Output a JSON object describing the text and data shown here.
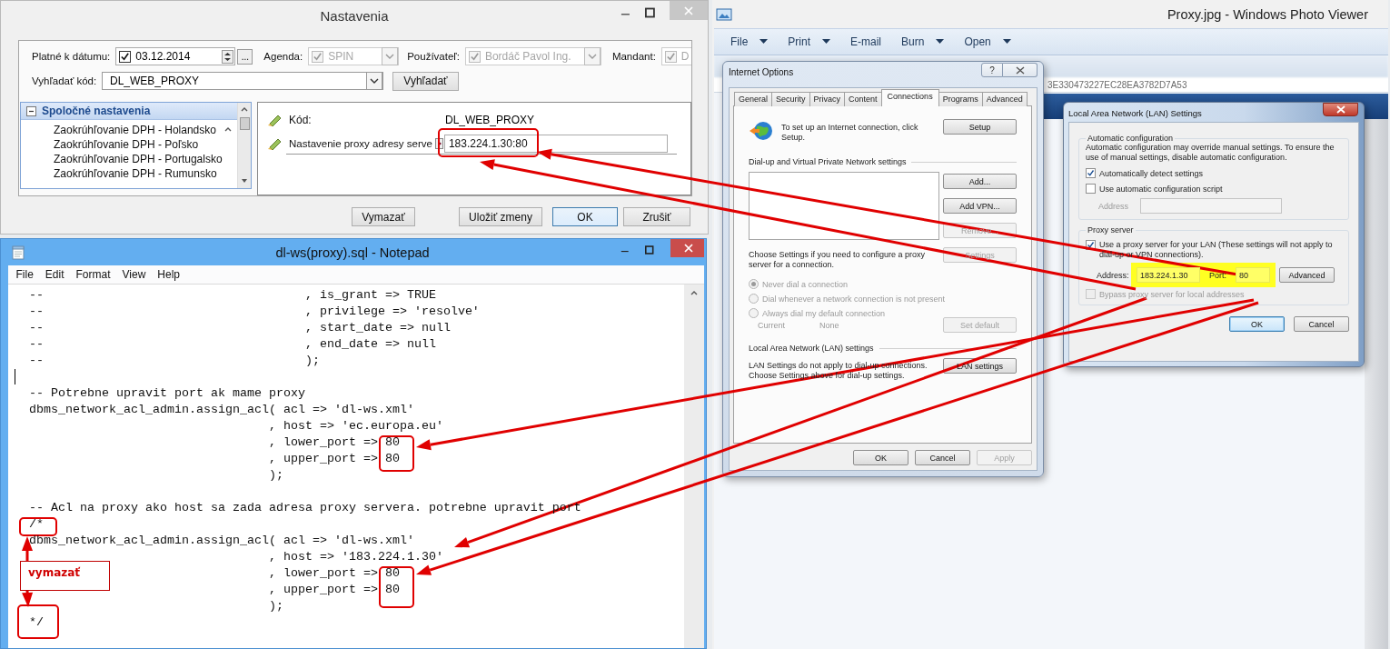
{
  "settings_window": {
    "title": "Nastavenia",
    "filters": [
      {
        "kind": "date",
        "label": "Platné k dátumu:",
        "checked": true,
        "disabled": false,
        "value": "03.12.2014",
        "browse": "..."
      },
      {
        "kind": "combo",
        "label": "Agenda:",
        "checked": true,
        "disabled": true,
        "value": "SPIN"
      },
      {
        "kind": "combo",
        "label": "Používateľ:",
        "checked": true,
        "disabled": true,
        "value": "Bordáč Pavol Ing."
      },
      {
        "kind": "combo",
        "label": "Mandant:",
        "checked": true,
        "disabled": true,
        "value": "D"
      }
    ],
    "search": {
      "label": "Vyhľadať kód:",
      "value": "DL_WEB_PROXY",
      "button": "Vyhľadať"
    },
    "tree": {
      "header": "Spoločné nastavenia",
      "expanded": true,
      "items": [
        "Zaokrúhľovanie DPH - Holandsko",
        "Zaokrúhľovanie DPH - Poľsko",
        "Zaokrúhľovanie DPH - Portugalsko",
        "Zaokrúhľovanie DPH - Rumunsko"
      ]
    },
    "details": [
      {
        "kind": "text",
        "label": "Kód:",
        "value": "DL_WEB_PROXY"
      },
      {
        "kind": "field",
        "label": "Nastavenie proxy adresy serve",
        "value": "183.224.1.30:80"
      }
    ],
    "buttons": [
      {
        "label": "Vymazať",
        "default": false
      },
      {
        "label": "Uložiť zmeny",
        "default": false
      },
      {
        "label": "OK",
        "default": true
      },
      {
        "label": "Zrušiť",
        "default": false
      }
    ]
  },
  "notepad": {
    "title": "dl-ws(proxy).sql - Notepad",
    "menu": [
      "File",
      "Edit",
      "Format",
      "View",
      "Help"
    ],
    "blocks": [
      {
        "caret_after": true,
        "lines": [
          "--                                    , is_grant => TRUE",
          "--                                    , privilege => 'resolve'",
          "--                                    , start_date => null",
          "--                                    , end_date => null",
          "--                                    );"
        ]
      },
      {
        "caret_after": false,
        "lines": [
          "-- Potrebne upravit port ak mame proxy",
          "dbms_network_acl_admin.assign_acl( acl => 'dl-ws.xml'",
          "                                 , host => 'ec.europa.eu'",
          "                                 , lower_port => 80",
          "                                 , upper_port => 80",
          "                                 );"
        ]
      },
      {
        "caret_after": false,
        "lines": [
          "-- Acl na proxy ako host sa zada adresa proxy servera. potrebne upravit port",
          "/*",
          "dbms_network_acl_admin.assign_acl( acl => 'dl-ws.xml'",
          "                                 , host => '183.224.1.30'",
          "                                 , lower_port => 80",
          "                                 , upper_port => 80",
          "                                 );",
          "*/"
        ]
      }
    ]
  },
  "photo_viewer": {
    "title": "Proxy.jpg - Windows Photo Viewer",
    "toolbar": [
      {
        "label": "File",
        "dropdown": true
      },
      {
        "label": "Print",
        "dropdown": true
      },
      {
        "label": "E-mail",
        "dropdown": false
      },
      {
        "label": "Burn",
        "dropdown": true
      },
      {
        "label": "Open",
        "dropdown": true
      }
    ],
    "image": {
      "address": "3E330473227EC28EA3782D7A53",
      "internet_options": {
        "title": "Internet Options",
        "help": "?",
        "tabs": [
          {
            "label": "General",
            "selected": false
          },
          {
            "label": "Security",
            "selected": false
          },
          {
            "label": "Privacy",
            "selected": false
          },
          {
            "label": "Content",
            "selected": false
          },
          {
            "label": "Connections",
            "selected": true
          },
          {
            "label": "Programs",
            "selected": false
          },
          {
            "label": "Advanced",
            "selected": false
          }
        ],
        "setup_text": "To set up an Internet connection, click Setup.",
        "setup_button": "Setup",
        "dialup_group": "Dial-up and Virtual Private Network settings",
        "dialup_buttons": [
          {
            "label": "Add...",
            "disabled": false
          },
          {
            "label": "Add VPN...",
            "disabled": false
          },
          {
            "label": "Remove...",
            "disabled": true
          },
          {
            "label": "Settings",
            "disabled": true
          }
        ],
        "proxy_text": "Choose Settings if you need to configure a proxy server for a connection.",
        "dial_options": [
          {
            "label": "Never dial a connection",
            "selected": true,
            "disabled": true
          },
          {
            "label": "Dial whenever a network connection is not present",
            "selected": false,
            "disabled": true
          },
          {
            "label": "Always dial my default connection",
            "selected": false,
            "disabled": true
          }
        ],
        "current_label": "Current",
        "current_value": "None",
        "set_default": {
          "label": "Set default",
          "disabled": true
        },
        "lan_group": "Local Area Network (LAN) settings",
        "lan_text": "LAN Settings do not apply to dial-up connections. Choose Settings above for dial-up settings.",
        "lan_button": "LAN settings",
        "footer": [
          {
            "label": "OK",
            "disabled": false
          },
          {
            "label": "Cancel",
            "disabled": false
          },
          {
            "label": "Apply",
            "disabled": true
          }
        ]
      },
      "lan_settings": {
        "title": "Local Area Network (LAN) Settings",
        "auto_group": "Automatic configuration",
        "auto_text": "Automatic configuration may override manual settings. To ensure the use of manual settings, disable automatic configuration.",
        "options": [
          {
            "label": "Automatically detect settings",
            "checked": true
          },
          {
            "label": "Use automatic configuration script",
            "checked": false
          }
        ],
        "script_address": {
          "label": "Address",
          "disabled": true
        },
        "proxy_group": "Proxy server",
        "proxy_option": {
          "label": "Use a proxy server for your LAN (These settings will not apply to dial-up or VPN connections).",
          "checked": true
        },
        "address_label": "Address:",
        "address": "183.224.1.30",
        "port_label": "Port:",
        "port": "80",
        "advanced": "Advanced",
        "bypass": {
          "label": "Bypass proxy server for local addresses",
          "checked": false,
          "disabled": true
        },
        "buttons": [
          {
            "label": "OK",
            "default": true
          },
          {
            "label": "Cancel",
            "default": false
          }
        ]
      }
    }
  },
  "annotations": {
    "note": "vymazať"
  }
}
